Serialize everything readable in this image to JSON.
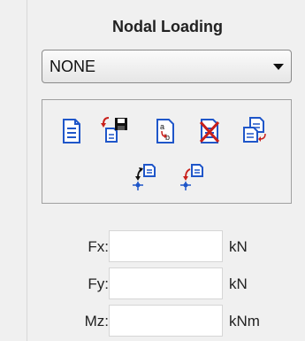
{
  "panel": {
    "title": "Nodal Loading"
  },
  "load_case_select": {
    "selected": "NONE"
  },
  "toolbar": {
    "buttons": [
      {
        "icon": "new-document-icon"
      },
      {
        "icon": "save-load-icon"
      },
      {
        "icon": "rename-load-icon"
      },
      {
        "icon": "delete-load-icon"
      },
      {
        "icon": "copy-load-icon"
      },
      {
        "icon": "assign-node-load-icon"
      },
      {
        "icon": "remove-node-load-icon"
      }
    ]
  },
  "fields": [
    {
      "label": "Fx:",
      "value": "",
      "unit": "kN"
    },
    {
      "label": "Fy:",
      "value": "",
      "unit": "kN"
    },
    {
      "label": "Mz:",
      "value": "",
      "unit": "kNm"
    }
  ],
  "colors": {
    "icon_blue": "#1f56c9",
    "icon_red": "#c8201b",
    "panel_bg": "#f0f0f0"
  }
}
